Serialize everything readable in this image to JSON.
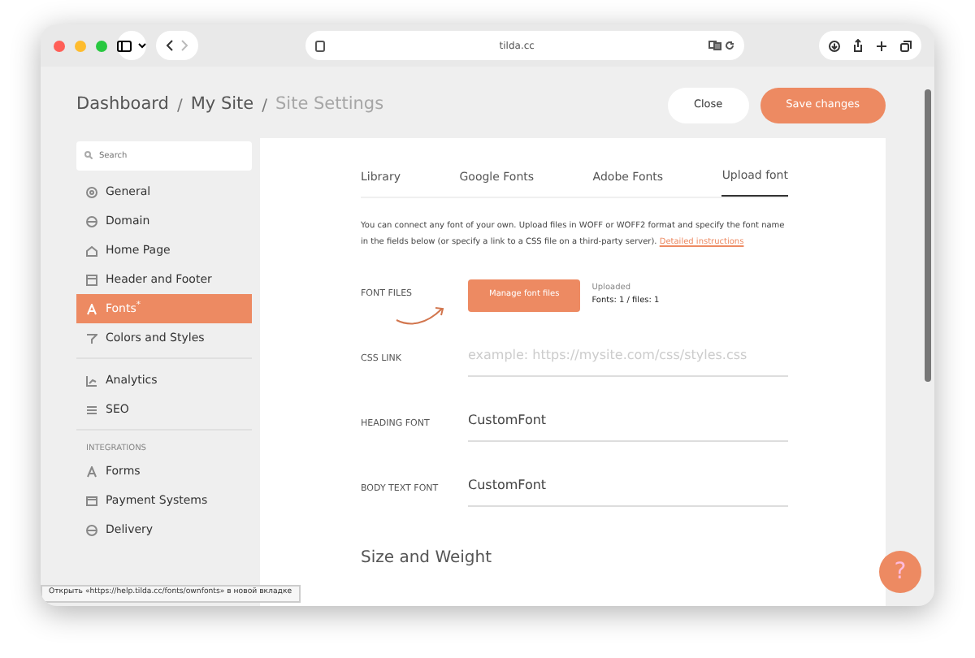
{
  "browser": {
    "address": "tilda.cc"
  },
  "breadcrumbs": [
    {
      "label": "Dashboard",
      "current": false
    },
    {
      "separator": "/",
      "label": "My Site",
      "current": false
    },
    {
      "separator": "/",
      "label": "Site Settings",
      "current": true
    }
  ],
  "actions": {
    "close": "Close",
    "save": "Save changes"
  },
  "sidebar": {
    "search": {
      "placeholder": "Search"
    },
    "groups": [
      {
        "items": [
          {
            "label": "General",
            "selected": false
          },
          {
            "label": "Domain",
            "selected": false
          },
          {
            "label": "Home Page",
            "selected": false
          },
          {
            "label": "Header and Footer",
            "selected": false
          },
          {
            "label": "Fonts$^{*}$",
            "selected": true
          },
          {
            "label": "Colors and Styles",
            "selected": false
          }
        ]
      },
      {
        "items": [
          {
            "label": "Analytics",
            "selected": false
          },
          {
            "label": "SEO",
            "selected": false
          }
        ]
      },
      {
        "heading": "INTEGRATIONS",
        "items": [
          {
            "label": "Forms",
            "selected": false
          },
          {
            "label": "Payment Systems",
            "selected": false
          },
          {
            "label": "Delivery",
            "selected": false
          }
        ]
      }
    ]
  },
  "tabs": [
    {
      "label": "Library",
      "selected": false
    },
    {
      "label": "Google Fonts",
      "selected": false
    },
    {
      "label": "Adobe Fonts",
      "selected": false
    },
    {
      "label": "Upload font",
      "selected": true
    }
  ],
  "intro": {
    "text": "You can connect any font of your own. Upload files in WOFF or WOFF2 format and specify the font name in the fields below (or specify a link to a CSS file on a third-party server).",
    "link": "Detailed instructions"
  },
  "fields": [
    {
      "kind": "files",
      "label": "FONT FILES",
      "button": "Manage font files",
      "status": "Uploaded",
      "count": "Fonts: 1 / files: 1"
    },
    {
      "kind": "input",
      "label": "CSS LINK",
      "placeholder": "example: https://mysite.com/css/styles.css"
    },
    {
      "kind": "input",
      "label": "HEADING FONT",
      "value": "CustomFont"
    },
    {
      "kind": "input",
      "label": "BODY TEXT FONT",
      "value": "CustomFont"
    }
  ],
  "section_title": "Size and Weight",
  "help": "?",
  "status_bar": "Открыть «https://help.tilda.cc/fonts/ownfonts» в новой вкладке"
}
